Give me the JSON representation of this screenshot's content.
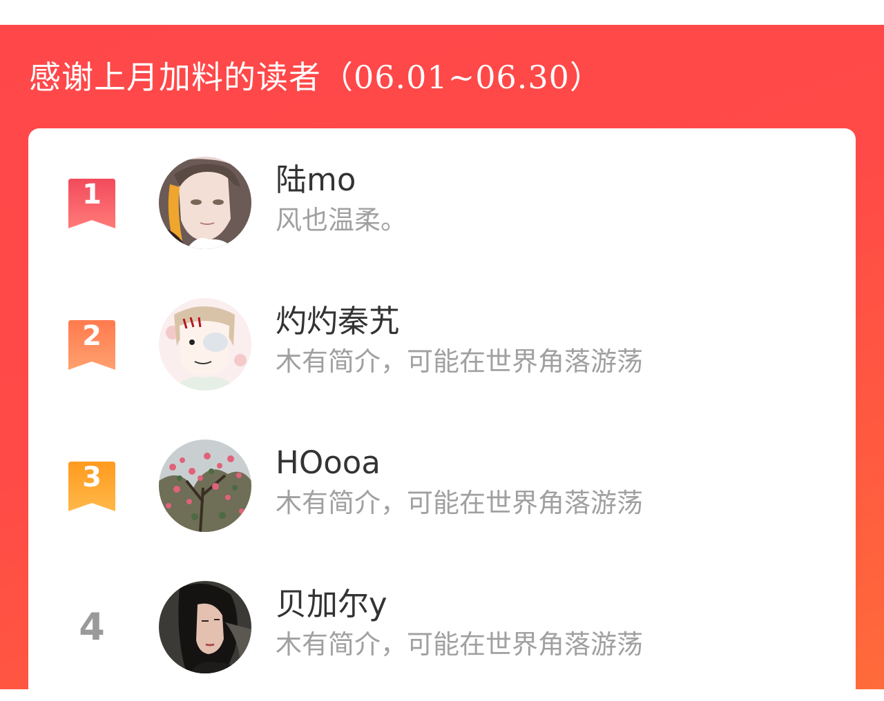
{
  "banner": {
    "title": "感谢上月加料的读者（06.01~06.30）"
  },
  "colors": {
    "banner": "#ff4a47",
    "rank1": "#fb5a62",
    "rank2": "#ff8a50",
    "rank3": "#ffa62a",
    "name_text": "#333333",
    "bio_text": "#a0a0a0",
    "plain_rank": "#9a9a9a"
  },
  "readers": [
    {
      "rank": "1",
      "name": "陆mo",
      "bio": "风也温柔。",
      "avatar": "anime-man-avatar"
    },
    {
      "rank": "2",
      "name": "灼灼秦艽",
      "bio": "木有简介，可能在世界角落游荡",
      "avatar": "cartoon-character-avatar"
    },
    {
      "rank": "3",
      "name": "HOooa",
      "bio": "木有简介，可能在世界角落游荡",
      "avatar": "flower-tree-avatar"
    },
    {
      "rank": "4",
      "name": "贝加尔y",
      "bio": "木有简介，可能在世界角落游荡",
      "avatar": "woman-portrait-avatar"
    }
  ]
}
